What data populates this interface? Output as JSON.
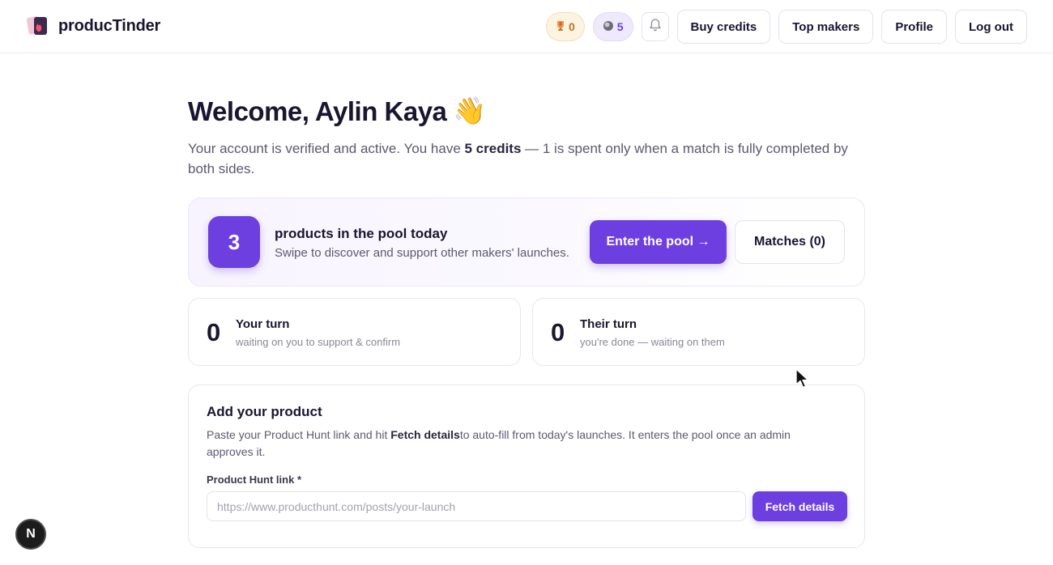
{
  "header": {
    "brand_name": "producTinder",
    "trophy_count": "0",
    "credits_count": "5",
    "nav": {
      "buy_credits": "Buy credits",
      "top_makers": "Top makers",
      "profile": "Profile",
      "logout": "Log out"
    }
  },
  "main": {
    "welcome": "Welcome, Aylin Kaya",
    "welcome_emoji": "👋",
    "sub_prefix": "Your account is verified and active. You have ",
    "sub_bold": "5 credits",
    "sub_suffix": " — 1 is spent only when a match is fully completed by both sides."
  },
  "pool": {
    "count": "3",
    "title": "products in the pool today",
    "desc": "Swipe to discover and support other makers' launches.",
    "enter_label": "Enter the pool →",
    "matches_label": "Matches (0)"
  },
  "turns": {
    "yours": {
      "count": "0",
      "title": "Your turn",
      "desc": "waiting on you to support & confirm"
    },
    "theirs": {
      "count": "0",
      "title": "Their turn",
      "desc": "you're done — waiting on them"
    }
  },
  "add_product": {
    "title": "Add your product",
    "desc_prefix": "Paste your Product Hunt link and hit ",
    "desc_bold": "Fetch details",
    "desc_suffix": "to auto-fill from today's launches. It enters the pool once an admin approves it.",
    "field_label": "Product Hunt link *",
    "placeholder": "https://www.producthunt.com/posts/your-launch",
    "fetch_label": "Fetch details"
  },
  "dev_badge": "N",
  "colors": {
    "accent": "#6d3fe0",
    "text": "#1a1530",
    "muted": "#5c5870"
  }
}
